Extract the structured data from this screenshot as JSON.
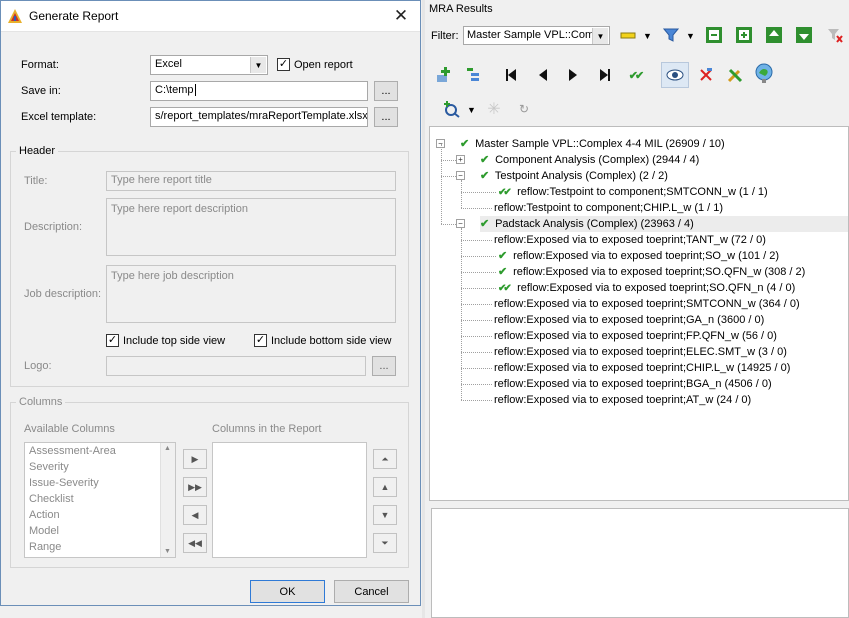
{
  "dialog": {
    "title": "Generate Report",
    "format_label": "Format:",
    "format_value": "Excel",
    "open_report_label": "Open report",
    "open_report_checked": true,
    "save_in_label": "Save in:",
    "save_in_value": "C:\\temp",
    "browse_label": "...",
    "excel_template_label": "Excel template:",
    "excel_template_value": "s/report_templates/mraReportTemplate.xlsx",
    "header_group": "Header",
    "title_label": "Title:",
    "title_placeholder": "Type here report title",
    "description_label": "Description:",
    "description_placeholder": "Type here report description",
    "job_description_label": "Job description:",
    "job_description_placeholder": "Type here job description",
    "include_top_label": "Include top side view",
    "include_top_checked": true,
    "include_bottom_label": "Include bottom side view",
    "include_bottom_checked": true,
    "logo_label": "Logo:",
    "columns_group": "Columns",
    "available_columns_label": "Available Columns",
    "columns_in_report_label": "Columns in the Report",
    "available_columns": [
      "Assessment-Area",
      "Severity",
      "Issue-Severity",
      "Checklist",
      "Action",
      "Model",
      "Range"
    ],
    "ok_label": "OK",
    "cancel_label": "Cancel"
  },
  "mra": {
    "title": "MRA Results",
    "filter_label": "Filter:",
    "filter_value": "Master Sample VPL::Compl",
    "tree": [
      {
        "text": "Master Sample VPL::Complex 4-4 MIL (26909 / 10)",
        "check": "single",
        "expander": "-",
        "level": 0
      },
      {
        "text": "Component Analysis (Complex) (2944 / 4)",
        "check": "single",
        "expander": "+",
        "level": 1
      },
      {
        "text": "Testpoint Analysis (Complex) (2 / 2)",
        "check": "single",
        "expander": "-",
        "level": 1
      },
      {
        "text": "reflow:Testpoint to component;SMTCONN_w (1 / 1)",
        "check": "double",
        "level": 2
      },
      {
        "text": "reflow:Testpoint to component;CHIP.L_w (1 / 1)",
        "check": "none",
        "level": 2
      },
      {
        "text": "Padstack Analysis (Complex) (23963 / 4)",
        "check": "single",
        "expander": "-",
        "level": 1,
        "selected": true
      },
      {
        "text": "reflow:Exposed via to exposed toeprint;TANT_w (72 / 0)",
        "check": "none",
        "level": 2
      },
      {
        "text": "reflow:Exposed via to exposed toeprint;SO_w (101 / 2)",
        "check": "single",
        "level": 2
      },
      {
        "text": "reflow:Exposed via to exposed toeprint;SO.QFN_w (308 / 2)",
        "check": "single",
        "level": 2
      },
      {
        "text": "reflow:Exposed via to exposed toeprint;SO.QFN_n (4 / 0)",
        "check": "double",
        "level": 2
      },
      {
        "text": "reflow:Exposed via to exposed toeprint;SMTCONN_w (364 / 0)",
        "check": "none",
        "level": 2
      },
      {
        "text": "reflow:Exposed via to exposed toeprint;GA_n (3600 / 0)",
        "check": "none",
        "level": 2
      },
      {
        "text": "reflow:Exposed via to exposed toeprint;FP.QFN_w (56 / 0)",
        "check": "none",
        "level": 2
      },
      {
        "text": "reflow:Exposed via to exposed toeprint;ELEC.SMT_w (3 / 0)",
        "check": "none",
        "level": 2
      },
      {
        "text": "reflow:Exposed via to exposed toeprint;CHIP.L_w (14925 / 0)",
        "check": "none",
        "level": 2
      },
      {
        "text": "reflow:Exposed via to exposed toeprint;BGA_n (4506 / 0)",
        "check": "none",
        "level": 2
      },
      {
        "text": "reflow:Exposed via to exposed toeprint;AT_w (24 / 0)",
        "check": "none",
        "level": 2
      }
    ]
  }
}
